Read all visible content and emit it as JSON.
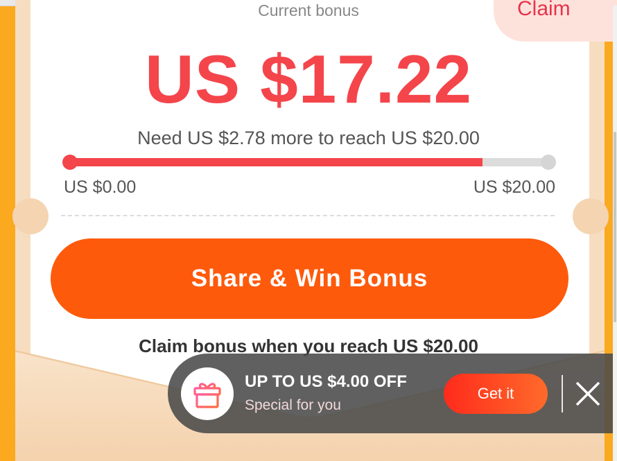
{
  "header": {
    "current_bonus_label": "Current bonus",
    "claim_label": "Claim",
    "amount": "US $17.22"
  },
  "progress": {
    "need_text": "Need US $2.78 more to reach US $20.00",
    "fraction": 0.861,
    "min_label": "US $0.00",
    "max_label": "US $20.00"
  },
  "actions": {
    "share_label": "Share & Win Bonus"
  },
  "hint": "Claim bonus when you reach US $20.00",
  "toast": {
    "title": "UP TO US $4.00 OFF",
    "subtitle": "Special for you",
    "cta_label": "Get it",
    "icon": "gift-icon",
    "close_icon": "close-icon"
  },
  "colors": {
    "accent": "#f4454b",
    "button": "#fe5a0c",
    "background": "#fba91f"
  }
}
